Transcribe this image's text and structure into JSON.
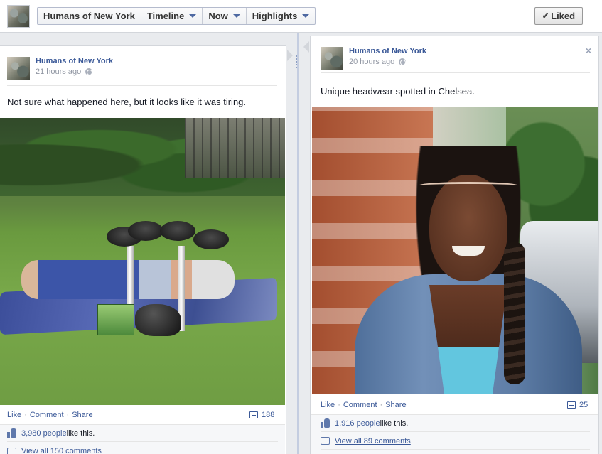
{
  "topbar": {
    "crumbs": [
      {
        "label": "Humans of New York",
        "caret": false
      },
      {
        "label": "Timeline",
        "caret": true
      },
      {
        "label": "Now",
        "caret": true
      },
      {
        "label": "Highlights",
        "caret": true
      }
    ],
    "liked_label": "Liked",
    "liked_icon": "check-icon"
  },
  "posts": [
    {
      "author": "Humans of New York",
      "time": "21 hours ago",
      "privacy_icon": "globe-icon",
      "message": "Not sure what happened here, but it looks like it was tiring.",
      "actions": {
        "like": "Like",
        "comment": "Comment",
        "share": "Share"
      },
      "comment_count": "188",
      "likes_count": "3,980 people",
      "likes_suffix": " like this.",
      "view_comments": "View all 150 comments"
    },
    {
      "author": "Humans of New York",
      "time": "20 hours ago",
      "privacy_icon": "globe-icon",
      "message": "Unique headwear spotted in Chelsea.",
      "close_label": "×",
      "actions": {
        "like": "Like",
        "comment": "Comment",
        "share": "Share"
      },
      "comment_count": "25",
      "likes_count": "1,916 people",
      "likes_suffix": " like this.",
      "view_comments": "View all 89 comments"
    }
  ],
  "colors": {
    "link": "#3b5998",
    "muted": "#9197a3",
    "background": "#e9ebee"
  }
}
